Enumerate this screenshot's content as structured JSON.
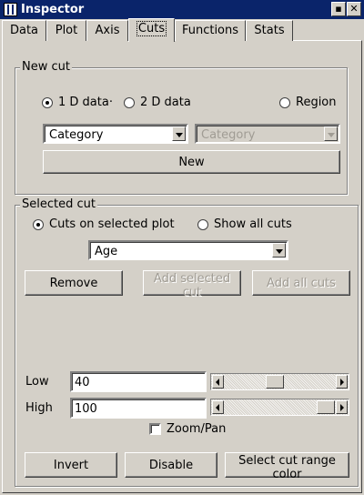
{
  "window": {
    "title": "Inspector",
    "minimize_glyph": "▪",
    "close_glyph": "✕"
  },
  "tabs": [
    {
      "label": "Data"
    },
    {
      "label": "Plot"
    },
    {
      "label": "Axis"
    },
    {
      "label": "Cuts",
      "selected": true
    },
    {
      "label": "Functions"
    },
    {
      "label": "Stats"
    }
  ],
  "new_cut": {
    "legend": "New cut",
    "radio_1d": "1 D data·",
    "radio_2d": "2 D data",
    "radio_region": "Region",
    "selected_mode": "1 D data",
    "category_combo_value": "Category",
    "category2_combo_value": "Category",
    "new_button": "New"
  },
  "selected_cut": {
    "legend": "Selected cut",
    "radio_on_plot": "Cuts on selected plot",
    "radio_show_all": "Show all cuts",
    "selected_mode": "Cuts on selected plot",
    "cut_combo_value": "Age",
    "remove_button": "Remove",
    "add_selected_button": "Add selected cut",
    "add_all_button": "Add all cuts",
    "low_label": "Low",
    "low_value": "40",
    "low_slider_fraction": 0.45,
    "high_label": "High",
    "high_value": "100",
    "high_slider_fraction": 1.0,
    "zoom_pan_label": "Zoom/Pan",
    "zoom_pan_checked": false,
    "invert_button": "Invert",
    "disable_button": "Disable",
    "color_button": "Select cut range color"
  },
  "colors": {
    "titlebar": "#0a246a",
    "face": "#d4d0c8"
  }
}
